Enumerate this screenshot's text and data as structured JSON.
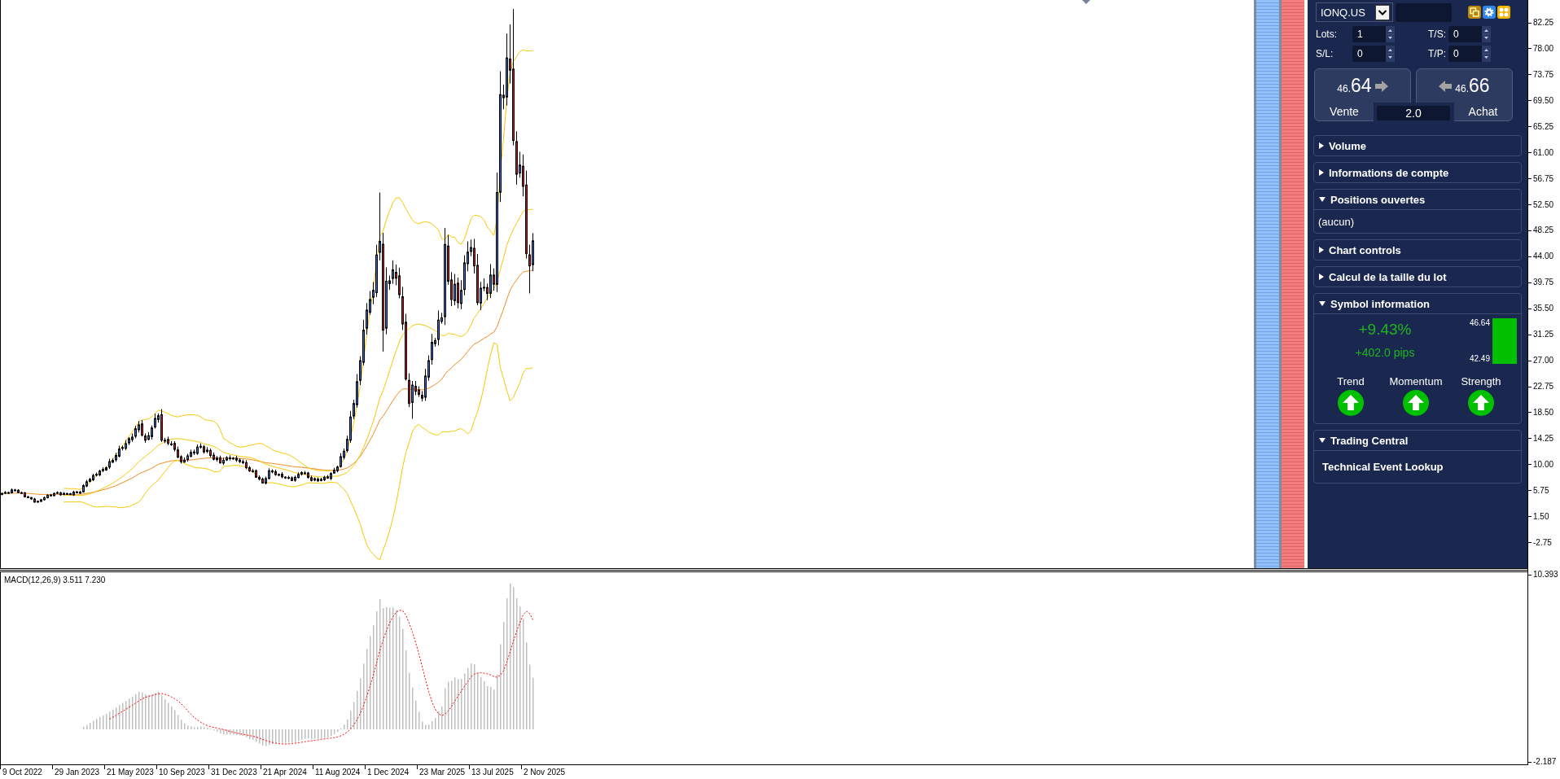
{
  "trade_panel": {
    "symbol": "IONQ.US",
    "order_fields": [
      {
        "label": "Lots:",
        "value": "1"
      },
      {
        "label": "T/S:",
        "value": "0"
      },
      {
        "label": "S/L:",
        "value": "0"
      },
      {
        "label": "T/P:",
        "value": "0"
      }
    ],
    "trade_buttons": [
      {
        "kind": "sell",
        "price_prefix": "46.",
        "price_main": "64",
        "label": "Vente"
      },
      {
        "kind": "buy",
        "price_prefix": "46.",
        "price_main": "66",
        "label": "Achat"
      }
    ],
    "lot_size": "2.0",
    "sections": [
      {
        "title": "Volume",
        "expanded": false
      },
      {
        "title": "Informations de compte",
        "expanded": false
      },
      {
        "title": "Positions ouvertes",
        "expanded": true,
        "body": {
          "kind": "text",
          "text": "(aucun)"
        }
      },
      {
        "title": "Chart controls",
        "expanded": false
      },
      {
        "title": "Calcul de la taille du lot",
        "expanded": false
      },
      {
        "title": "Symbol information",
        "expanded": true,
        "body": {
          "kind": "symbol_info",
          "change_percent": "+9.43%",
          "change_pips": "+402.0 pips",
          "range_high": "46.64",
          "range_low": "42.49",
          "indicators": [
            {
              "label": "Trend",
              "up": true
            },
            {
              "label": "Momentum",
              "up": true
            },
            {
              "label": "Strength",
              "up": true
            }
          ]
        }
      },
      {
        "title": "Trading Central",
        "expanded": true,
        "body": {
          "kind": "link",
          "text": "Technical Event Lookup"
        }
      }
    ]
  },
  "price_axis": {
    "labels": [
      "82.25",
      "78.00",
      "73.75",
      "69.50",
      "65.25",
      "61.00",
      "56.75",
      "52.50",
      "48.25",
      "44.00",
      "39.75",
      "35.50",
      "31.25",
      "27.00",
      "22.75",
      "18.50",
      "14.25",
      "10.00",
      "5.75",
      "1.50",
      "-2.75"
    ]
  },
  "macd": {
    "label": "MACD(12,26,9) 3.511 7.230",
    "axis_labels": [
      "10.393",
      "-2.187"
    ]
  },
  "time_axis": {
    "labels": [
      "9 Oct 2022",
      "29 Jan 2023",
      "21 May 2023",
      "10 Sep 2023",
      "31 Dec 2023",
      "21 Apr 2024",
      "11 Aug 2024",
      "1 Dec 2024",
      "23 Mar 2025",
      "13 Jul 2025",
      "2 Nov 2025"
    ]
  }
}
